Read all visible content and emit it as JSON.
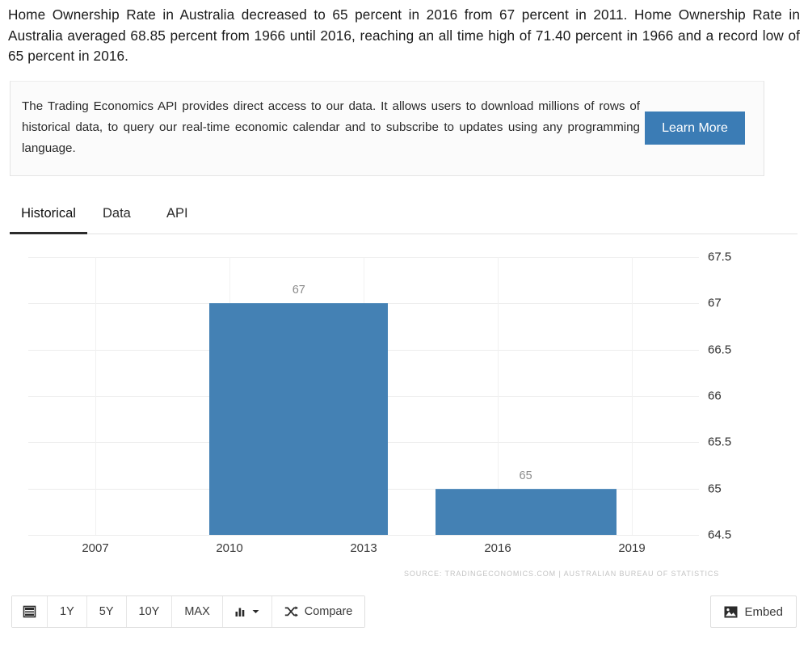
{
  "intro": {
    "paragraph": "Home Ownership Rate in Australia decreased to 65 percent in 2016 from 67 percent in 2011. Home Ownership Rate in Australia averaged 68.85 percent from 1966 until 2016, reaching an all time high of 71.40 percent in 1966 and a record low of 65 percent in 2016."
  },
  "promo": {
    "text": "The Trading Economics API provides direct access to our data. It allows users to download millions of rows of historical data, to query our real-time economic calendar and to subscribe to updates using any programming language.",
    "button_label": "Learn More",
    "button_color": "#3b7cb5"
  },
  "tabs": [
    {
      "label": "Historical",
      "active": true
    },
    {
      "label": "Data",
      "active": false
    },
    {
      "label": "API",
      "active": false
    }
  ],
  "chart_data": {
    "type": "bar",
    "title": "",
    "xlabel": "",
    "ylabel": "",
    "categories": [
      "2011",
      "2016"
    ],
    "values": [
      67,
      65
    ],
    "data_labels": [
      "67",
      "65"
    ],
    "bar_color": "#4481b4",
    "ylim": [
      64.5,
      67.5
    ],
    "yticks": [
      "67.5",
      "67",
      "66.5",
      "66",
      "65.5",
      "65",
      "64.5"
    ],
    "ytick_values": [
      67.5,
      67,
      66.5,
      66,
      65.5,
      65,
      64.5
    ],
    "xticks": [
      "2007",
      "2010",
      "2013",
      "2016",
      "2019"
    ],
    "xtick_values": [
      2007,
      2010,
      2013,
      2016,
      2019
    ],
    "xlim": [
      2005.5,
      2020.5
    ],
    "grid": true,
    "legend": "none",
    "yaxis_position": "right",
    "source": "SOURCE: TRADINGECONOMICS.COM | AUSTRALIAN BUREAU OF STATISTICS"
  },
  "toolbar": {
    "buttons": [
      {
        "label": "",
        "icon": "list-icon"
      },
      {
        "label": "1Y",
        "icon": ""
      },
      {
        "label": "5Y",
        "icon": ""
      },
      {
        "label": "10Y",
        "icon": ""
      },
      {
        "label": "MAX",
        "icon": ""
      },
      {
        "label": "",
        "icon": "bar-chart-dropdown-icon"
      },
      {
        "label": "Compare",
        "icon": "shuffle-icon"
      }
    ],
    "embed_label": "Embed"
  }
}
